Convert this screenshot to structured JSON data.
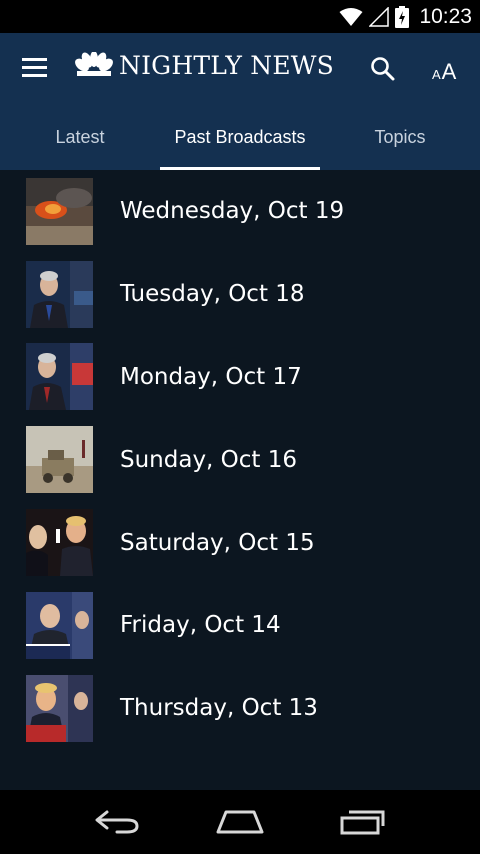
{
  "status_bar": {
    "time": "10:23",
    "icons": [
      "wifi-icon",
      "signal-icon",
      "battery-charging-icon"
    ]
  },
  "header": {
    "brand_name": "NIGHTLY NEWS",
    "logo_icon": "nbc-peacock-icon",
    "menu_icon": "hamburger-menu-icon",
    "search_icon": "search-icon",
    "text_size": {
      "small": "A",
      "large": "A"
    }
  },
  "tabs": [
    {
      "label": "Latest",
      "active": false
    },
    {
      "label": "Past Broadcasts",
      "active": true
    },
    {
      "label": "Topics",
      "active": false
    }
  ],
  "broadcasts": [
    {
      "date": "Wednesday, Oct 19"
    },
    {
      "date": "Tuesday, Oct 18"
    },
    {
      "date": "Monday, Oct 17"
    },
    {
      "date": "Sunday, Oct 16"
    },
    {
      "date": "Saturday, Oct 15"
    },
    {
      "date": "Friday, Oct 14"
    },
    {
      "date": "Thursday, Oct 13"
    }
  ],
  "nav_bar": {
    "icons": [
      "back-icon",
      "home-icon",
      "recent-apps-icon"
    ]
  },
  "colors": {
    "header_bg": "#143050",
    "list_bg": "#0c1620",
    "tab_inactive": "#c8d2de",
    "status_bg": "#000000"
  }
}
